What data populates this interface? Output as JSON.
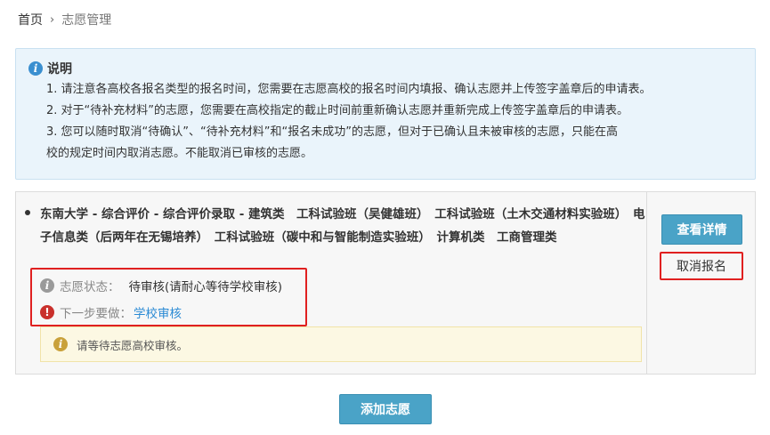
{
  "breadcrumb": {
    "home": "首页",
    "separator": "›",
    "current": "志愿管理"
  },
  "notice": {
    "icon": "info-icon",
    "title": "说明",
    "lines": [
      "1. 请注意各高校各报名类型的报名时间，您需要在志愿高校的报名时间内填报、确认志愿并上传签字盖章后的申请表。",
      "2. 对于“待补充材料”的志愿，您需要在高校指定的截止时间前重新确认志愿并重新完成上传签字盖章后的申请表。",
      "3. 您可以随时取消“待确认”、“待补充材料”和“报名未成功”的志愿，但对于已确认且未被审核的志愿，只能在高",
      "校的规定时间内取消志愿。不能取消已审核的志愿。"
    ]
  },
  "application": {
    "program": "东南大学 - 综合评价 - 综合评价录取 - 建筑类　工科试验班（吴健雄班）　工科试验班（土木交通材料实验班）　电子信息类（后两年在无锡培养）　工科试验班（碳中和与智能制造实验班）　计算机类　工商管理类",
    "status_label": "志愿状态：",
    "status_value": "待审核(请耐心等待学校审核)",
    "next_label": "下一步要做：",
    "next_value": "学校审核",
    "tip": "请等待志愿高校审核。",
    "detail_button": "查看详情",
    "cancel_button": "取消报名"
  },
  "add_button": "添加志愿",
  "colors": {
    "primary_button": "#4aa3c7",
    "highlight_border": "#e02020",
    "link": "#2a8ad4",
    "notice_bg": "#eaf4fb",
    "tip_bg": "#fcf8e3"
  }
}
